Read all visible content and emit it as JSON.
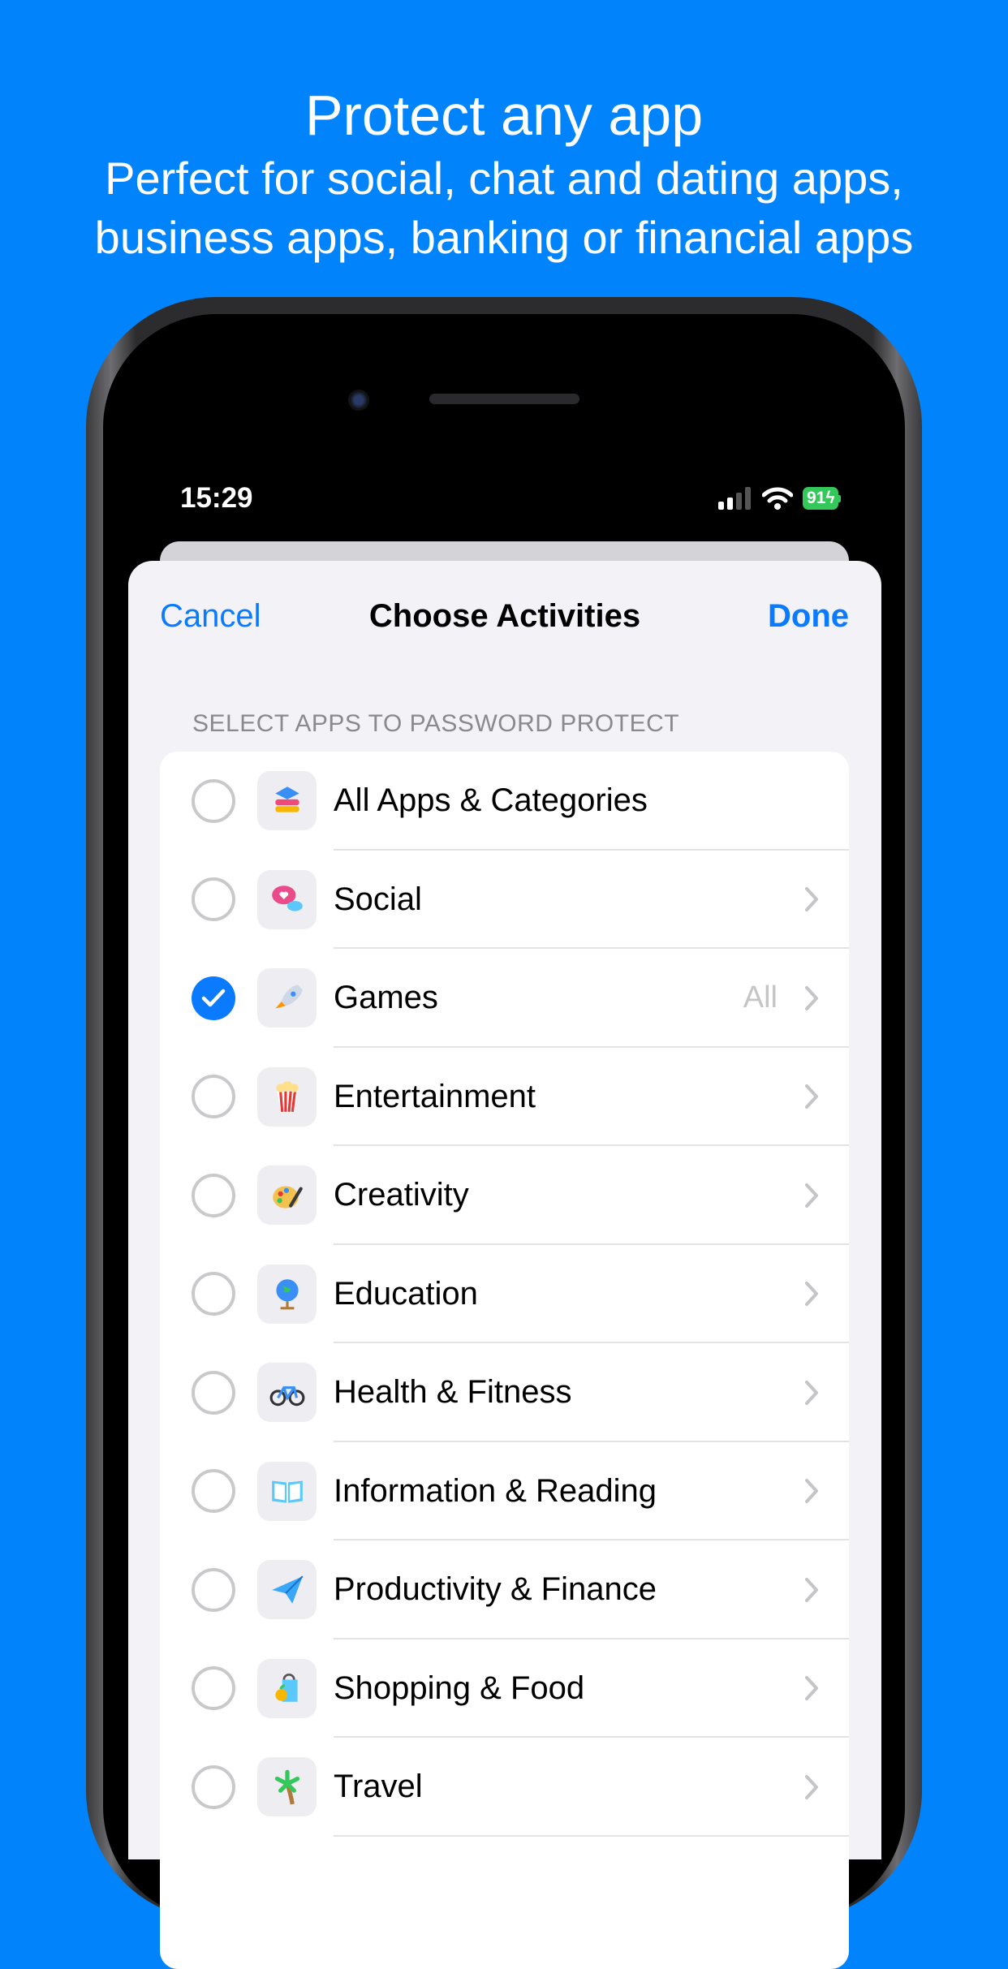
{
  "promo": {
    "title": "Protect any app",
    "subtitle_line1": "Perfect for social, chat and dating apps,",
    "subtitle_line2": "business apps, banking or financial apps"
  },
  "status_bar": {
    "time": "15:29",
    "battery": "91",
    "charging": true
  },
  "nav": {
    "cancel_label": "Cancel",
    "title": "Choose Activities",
    "done_label": "Done"
  },
  "section_header": "SELECT APPS TO PASSWORD PROTECT",
  "colors": {
    "background": "#0183fb",
    "accent": "#0a7aff",
    "battery": "#34c759"
  },
  "categories": [
    {
      "label": "All Apps & Categories",
      "icon": "stack-icon",
      "selected": false,
      "chevron": false,
      "detail": ""
    },
    {
      "label": "Social",
      "icon": "speech-bubbles-heart-icon",
      "selected": false,
      "chevron": true,
      "detail": ""
    },
    {
      "label": "Games",
      "icon": "rocket-icon",
      "selected": true,
      "chevron": true,
      "detail": "All"
    },
    {
      "label": "Entertainment",
      "icon": "popcorn-icon",
      "selected": false,
      "chevron": true,
      "detail": ""
    },
    {
      "label": "Creativity",
      "icon": "palette-icon",
      "selected": false,
      "chevron": true,
      "detail": ""
    },
    {
      "label": "Education",
      "icon": "globe-icon",
      "selected": false,
      "chevron": true,
      "detail": ""
    },
    {
      "label": "Health & Fitness",
      "icon": "bicycle-icon",
      "selected": false,
      "chevron": true,
      "detail": ""
    },
    {
      "label": "Information & Reading",
      "icon": "book-icon",
      "selected": false,
      "chevron": true,
      "detail": ""
    },
    {
      "label": "Productivity & Finance",
      "icon": "paper-plane-icon",
      "selected": false,
      "chevron": true,
      "detail": ""
    },
    {
      "label": "Shopping & Food",
      "icon": "shopping-bag-icon",
      "selected": false,
      "chevron": true,
      "detail": ""
    },
    {
      "label": "Travel",
      "icon": "palm-tree-icon",
      "selected": false,
      "chevron": true,
      "detail": ""
    }
  ]
}
